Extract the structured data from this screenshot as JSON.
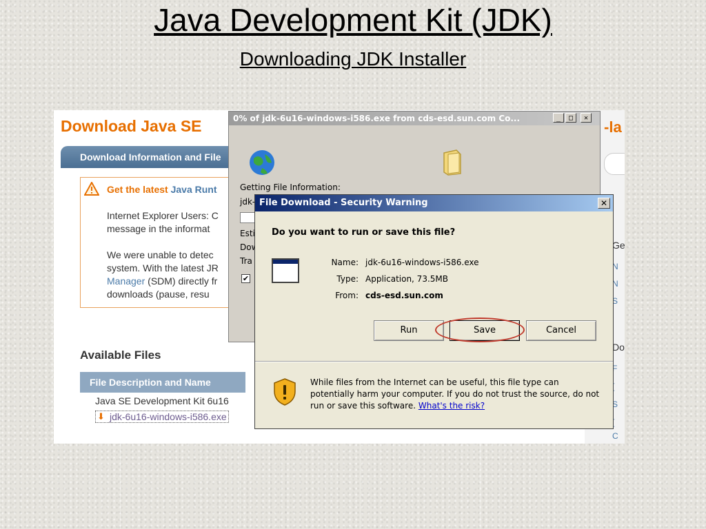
{
  "slide": {
    "title": "Java Development Kit (JDK)",
    "subtitle": "Downloading JDK Installer"
  },
  "webpage": {
    "heading": "Download Java SE",
    "tab_label": "Download Information and File",
    "info_title_orange": "Get the latest",
    "info_title_link": "Java Runt",
    "info_lines": [
      "Internet Explorer Users: C",
      "message in the informat",
      "We were unable to detec",
      "system. With the latest JR",
      "(SDM) directly fr",
      "downloads (pause, resu"
    ],
    "info_link_manager": "Manager",
    "available_files": "Available Files",
    "file_bar": "File Description and Name",
    "file_item": "Java SE Development Kit 6u16",
    "file_link": "jdk-6u16-windows-i586.exe",
    "right_col": {
      "top_fragment": "-la",
      "ge": "Ge",
      "do": "Do",
      "bullets_1": [
        "N",
        "N",
        "S"
      ],
      "bullets_2": [
        "F",
        "[",
        "S",
        "[",
        "C"
      ]
    }
  },
  "progress_window": {
    "title": "0% of jdk-6u16-windows-i586.exe from cds-esd.sun.com Co...",
    "minimize": "_",
    "maximize": "□",
    "close": "✕",
    "getting_info": "Getting File Information:",
    "file_frag": "jdk-",
    "est_frag": "Esti",
    "dow_frag": "Dow",
    "tra_frag": "Tra",
    "check_mark": "✔"
  },
  "dialog": {
    "title": "File Download - Security Warning",
    "close": "✕",
    "question": "Do you want to run or save this file?",
    "name_label": "Name:",
    "name_value": "jdk-6u16-windows-i586.exe",
    "type_label": "Type:",
    "type_value": "Application, 73.5MB",
    "from_label": "From:",
    "from_value": "cds-esd.sun.com",
    "run_button": "Run",
    "save_button": "Save",
    "cancel_button": "Cancel",
    "warning_text": "While files from the Internet can be useful, this file type can potentially harm your computer. If you do not trust the source, do not run or save this software.",
    "warning_link": "What's the risk?"
  },
  "colors": {
    "java_orange": "#e76f00",
    "dialog_title_start": "#0a246a",
    "highlight_ring": "#c0392b"
  }
}
